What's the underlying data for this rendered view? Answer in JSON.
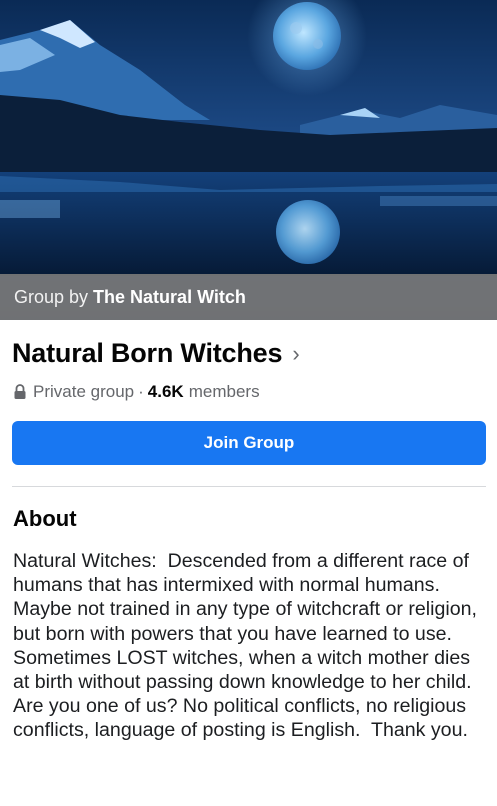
{
  "cover": {
    "caption_prefix": "Group by",
    "caption_owner": "The Natural Witch"
  },
  "group": {
    "name": "Natural Born Witches",
    "chevron": "›",
    "privacy": "Private group",
    "separator": "·",
    "member_count": "4.6K",
    "member_label": "members"
  },
  "actions": {
    "join_label": "Join Group"
  },
  "about": {
    "heading": "About",
    "text": "Natural Witches:  Descended from a different race of humans that has intermixed with normal humans.  Maybe not trained in any type of witchcraft or religion, but born with powers that you have learned to use.  Sometimes LOST witches, when a witch mother dies at birth without passing down knowledge to her child.  Are you one of us? No political conflicts, no religious conflicts, language of posting is English.  Thank you."
  },
  "colors": {
    "primary": "#1877f2",
    "secondary_text": "#65676b",
    "caption_bg": "#787878"
  },
  "icons": {
    "privacy": "lock-icon",
    "title": "chevron-right-icon"
  }
}
